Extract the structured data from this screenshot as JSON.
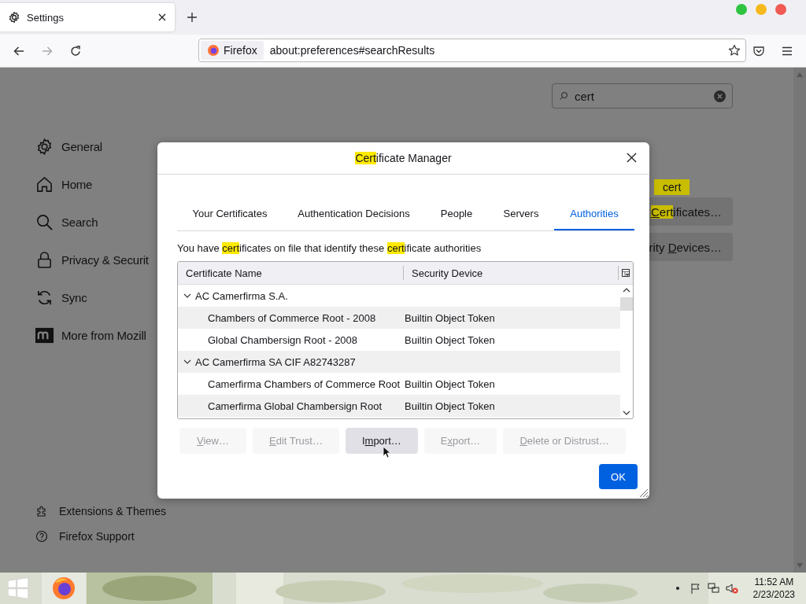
{
  "browser": {
    "tab": {
      "title": "Settings"
    },
    "identity": "Firefox",
    "url": "about:preferences#searchResults"
  },
  "search": {
    "value": "cert"
  },
  "sidebar": {
    "items": [
      {
        "label": "General"
      },
      {
        "label": "Home"
      },
      {
        "label": "Search"
      },
      {
        "label": "Privacy & Securit"
      },
      {
        "label": "Sync"
      },
      {
        "label": "More from Mozill"
      }
    ],
    "footer": [
      {
        "label": "Extensions & Themes"
      },
      {
        "label": "Firefox Support"
      }
    ]
  },
  "results": {
    "tooltip": "cert",
    "buttons": [
      {
        "parts": [
          {
            "text": "C",
            "highlighted": true,
            "accesskey": true
          },
          {
            "text": "ert",
            "highlighted": true,
            "accesskey": false
          },
          {
            "text": "ificates…",
            "highlighted": false,
            "accesskey": false
          }
        ]
      },
      {
        "parts": [
          {
            "text": "rity ",
            "highlighted": false,
            "accesskey": false
          },
          {
            "text": "D",
            "highlighted": false,
            "accesskey": true
          },
          {
            "text": "evices…",
            "highlighted": false,
            "accesskey": false
          }
        ]
      }
    ]
  },
  "dialog": {
    "title": [
      {
        "text": "Cert",
        "highlighted": true
      },
      {
        "text": "ificate Manager",
        "highlighted": false
      }
    ],
    "tabs": [
      {
        "label": "Your Certificates",
        "selected": false
      },
      {
        "label": "Authentication Decisions",
        "selected": false
      },
      {
        "label": "People",
        "selected": false
      },
      {
        "label": "Servers",
        "selected": false
      },
      {
        "label": "Authorities",
        "selected": true
      }
    ],
    "description": [
      {
        "text": "You have ",
        "highlighted": false
      },
      {
        "text": "cert",
        "highlighted": true
      },
      {
        "text": "ificates on file that identify these ",
        "highlighted": false
      },
      {
        "text": "cert",
        "highlighted": true
      },
      {
        "text": "ificate authorities",
        "highlighted": false
      }
    ],
    "columns": [
      "Certificate Name",
      "Security Device"
    ],
    "tree": [
      {
        "name": "AC Camerfirma S.A.",
        "expanded": true,
        "children": [
          {
            "name": "Chambers of Commerce Root - 2008",
            "device": "Builtin Object Token"
          },
          {
            "name": "Global Chambersign Root - 2008",
            "device": "Builtin Object Token"
          }
        ]
      },
      {
        "name": "AC Camerfirma SA CIF A82743287",
        "expanded": true,
        "children": [
          {
            "name": "Camerfirma Chambers of Commerce Root",
            "device": "Builtin Object Token"
          },
          {
            "name": "Camerfirma Global Chambersign Root",
            "device": "Builtin Object Token"
          }
        ]
      }
    ],
    "buttons": [
      {
        "parts": [
          {
            "text": "V",
            "accesskey": true
          },
          {
            "text": "iew…",
            "accesskey": false
          }
        ],
        "disabled": true
      },
      {
        "parts": [
          {
            "text": "E",
            "accesskey": true
          },
          {
            "text": "dit Trust…",
            "accesskey": false
          }
        ],
        "disabled": true
      },
      {
        "parts": [
          {
            "text": "I",
            "accesskey": false
          },
          {
            "text": "m",
            "accesskey": true
          },
          {
            "text": "port…",
            "accesskey": false
          }
        ],
        "disabled": false
      },
      {
        "parts": [
          {
            "text": "E",
            "accesskey": false
          },
          {
            "text": "x",
            "accesskey": true
          },
          {
            "text": "port…",
            "accesskey": false
          }
        ],
        "disabled": true
      },
      {
        "parts": [
          {
            "text": "D",
            "accesskey": true
          },
          {
            "text": "elete or Distrust…",
            "accesskey": false
          }
        ],
        "disabled": true
      }
    ],
    "ok": "OK"
  },
  "taskbar": {
    "time": "11:52 AM",
    "date": "2/23/2023"
  }
}
